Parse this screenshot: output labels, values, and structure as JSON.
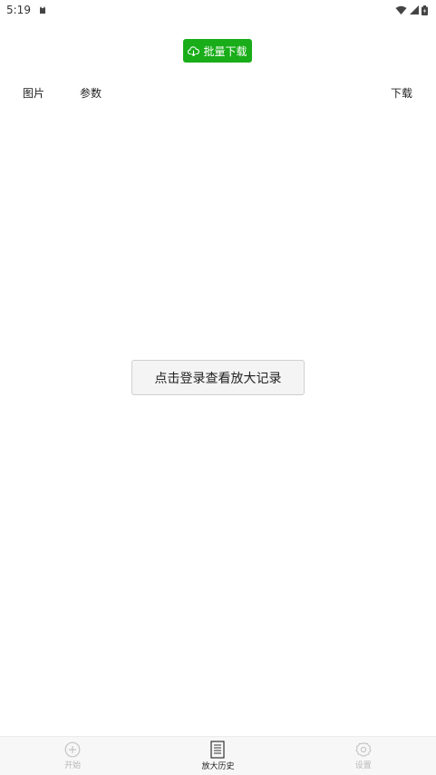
{
  "status_bar": {
    "time": "5:19"
  },
  "toolbar": {
    "batch_download_label": "批量下载",
    "accent_color": "#19ad19"
  },
  "table_header": {
    "image": "图片",
    "params": "参数",
    "download": "下载"
  },
  "main": {
    "login_prompt": "点击登录查看放大记录"
  },
  "bottom_nav": {
    "items": [
      {
        "label": "开始",
        "icon": "plus-circle-icon",
        "active": false
      },
      {
        "label": "放大历史",
        "icon": "list-document-icon",
        "active": true
      },
      {
        "label": "设置",
        "icon": "gear-icon",
        "active": false
      }
    ]
  }
}
